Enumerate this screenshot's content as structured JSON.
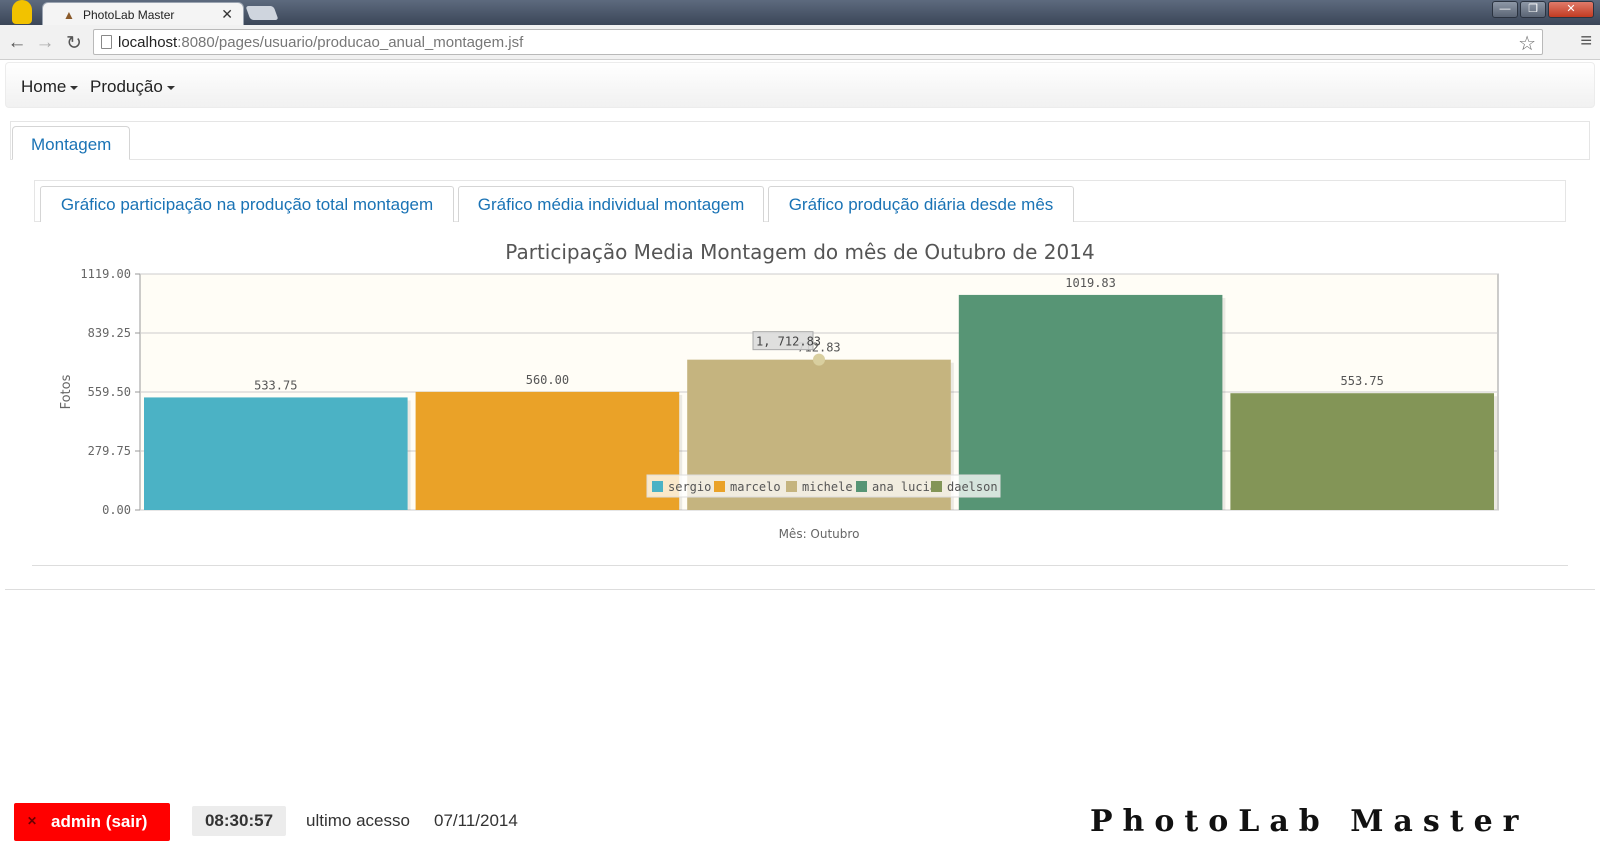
{
  "browser": {
    "tab_title": "PhotoLab Master",
    "tab_close": "✕",
    "url_host": "localhost",
    "url_path": ":8080/pages/usuario/producao_anual_montagem.jsf",
    "back": "←",
    "forward": "→",
    "reload": "↻",
    "star": "☆",
    "menu": "≡",
    "win_min": "—",
    "win_max": "❐",
    "win_close": "✕"
  },
  "navbar": {
    "items": [
      {
        "label": "Home"
      },
      {
        "label": "Produção"
      }
    ]
  },
  "outer_tab": {
    "label": "Montagem"
  },
  "inner_tabs": [
    {
      "label": "Gráfico participação na produção total montagem"
    },
    {
      "label": "Gráfico média individual montagem"
    },
    {
      "label": "Gráfico produção diária desde mês"
    }
  ],
  "chart_data": {
    "type": "bar",
    "title": "Participação Media Montagem do mês de Outubro de 2014",
    "xlabel": "Mês: Outubro",
    "ylabel": "Fotos",
    "ylim": [
      0,
      1119
    ],
    "yticks": [
      "0.00",
      "279.75",
      "559.50",
      "839.25",
      "1119.00"
    ],
    "categories": [
      "sergio",
      "marcelo",
      "michele",
      "ana lucia",
      "daelson"
    ],
    "values": [
      533.75,
      560.0,
      712.83,
      1019.83,
      553.75
    ],
    "value_labels": [
      "533.75",
      "560.00",
      "712.83",
      "1019.83",
      "553.75"
    ],
    "colors": [
      "#4bb2c5",
      "#eaa228",
      "#c5b47f",
      "#579575",
      "#839557"
    ],
    "tooltip": "1, 712.83",
    "legend_position": "bottom-center inside",
    "grid": true
  },
  "footer": {
    "logout_icon": "✕",
    "logout_label": "admin (sair)",
    "clock": "08:30:57",
    "last_access_label": "ultimo acesso",
    "last_access_date": "07/11/2014",
    "brand": "PhotoLab Master"
  }
}
